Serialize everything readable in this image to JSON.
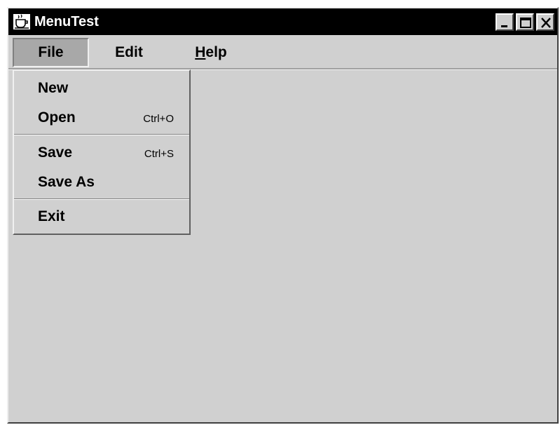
{
  "window": {
    "title": "MenuTest",
    "app_icon": "java-cup-icon",
    "controls": [
      "minimize-icon",
      "maximize-icon",
      "close-icon"
    ]
  },
  "menubar": {
    "items": [
      {
        "label": "File",
        "open": true
      },
      {
        "label": "Edit",
        "open": false
      },
      {
        "label_prefix": "",
        "mnemonic": "H",
        "label_suffix": "elp",
        "open": false
      }
    ]
  },
  "file_menu": {
    "items": [
      {
        "label": "New",
        "accelerator": ""
      },
      {
        "label": "Open",
        "accelerator": "Ctrl+O"
      },
      {
        "label": "Save",
        "accelerator": "Ctrl+S"
      },
      {
        "label": "Save As",
        "accelerator": ""
      },
      {
        "label": "Exit",
        "accelerator": ""
      }
    ]
  },
  "colors": {
    "titlebar": "#000000",
    "face": "#d0d0d0",
    "selected_menu": "#a8a8a8"
  }
}
